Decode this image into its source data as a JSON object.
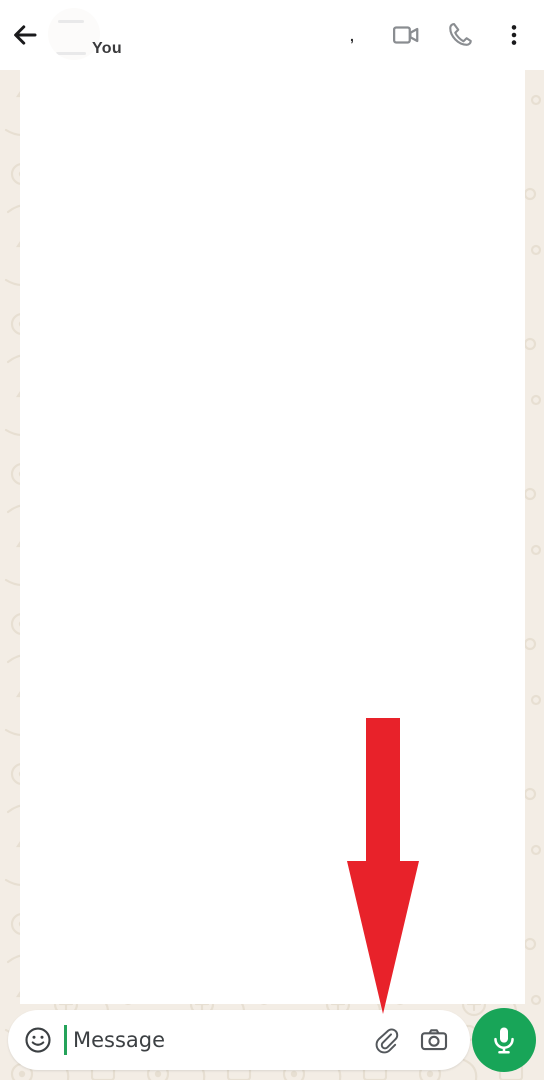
{
  "app": "WhatsApp Chat",
  "header": {
    "back_icon": "back-arrow-icon",
    "avatar": "contact-avatar",
    "title": "",
    "title_emoji": "",
    "subtitle": "You",
    "tiny_mark": ",",
    "actions": [
      {
        "name": "video-call",
        "icon": "video-camera-icon"
      },
      {
        "name": "voice-call",
        "icon": "phone-icon"
      },
      {
        "name": "overflow-menu",
        "icon": "three-dots-vertical-icon"
      }
    ]
  },
  "chat": {
    "messages": []
  },
  "composer": {
    "emoji_icon": "smiley-face-icon",
    "placeholder": "Message",
    "value": "",
    "attach_icon": "paperclip-icon",
    "camera_icon": "camera-icon",
    "mic_icon": "microphone-icon"
  },
  "annotation": {
    "type": "down-arrow",
    "color": "#e8222a",
    "points_to": "attach-button"
  },
  "colors": {
    "accent_green": "#18a558",
    "caret_green": "#25a35a",
    "wallpaper": "#f3ede5",
    "panel_white": "#ffffff",
    "icon_gray": "#8a8d91",
    "annotation_red": "#e8222a"
  }
}
